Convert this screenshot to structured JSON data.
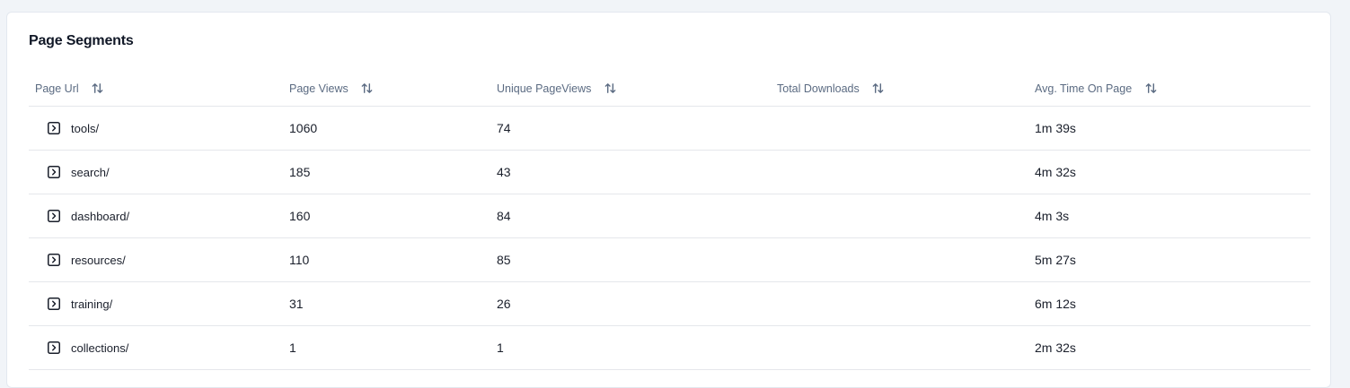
{
  "card": {
    "title": "Page Segments"
  },
  "table": {
    "columns": [
      {
        "key": "page_url",
        "label": "Page Url",
        "icon": "sort-icon"
      },
      {
        "key": "page_views",
        "label": "Page Views",
        "icon": "sort-icon"
      },
      {
        "key": "unique_pageviews",
        "label": "Unique PageViews",
        "icon": "sort-icon"
      },
      {
        "key": "total_downloads",
        "label": "Total Downloads",
        "icon": "sort-icon"
      },
      {
        "key": "avg_time",
        "label": "Avg. Time On Page",
        "icon": "sort-icon"
      }
    ],
    "rows": [
      {
        "page_url": "tools/",
        "page_views": "1060",
        "unique_pageviews": "74",
        "total_downloads": "",
        "avg_time": "1m 39s"
      },
      {
        "page_url": "search/",
        "page_views": "185",
        "unique_pageviews": "43",
        "total_downloads": "",
        "avg_time": "4m 32s"
      },
      {
        "page_url": "dashboard/",
        "page_views": "160",
        "unique_pageviews": "84",
        "total_downloads": "",
        "avg_time": "4m 3s"
      },
      {
        "page_url": "resources/",
        "page_views": "110",
        "unique_pageviews": "85",
        "total_downloads": "",
        "avg_time": "5m 27s"
      },
      {
        "page_url": "training/",
        "page_views": "31",
        "unique_pageviews": "26",
        "total_downloads": "",
        "avg_time": "6m 12s"
      },
      {
        "page_url": "collections/",
        "page_views": "1",
        "unique_pageviews": "1",
        "total_downloads": "",
        "avg_time": "2m 32s"
      }
    ],
    "row_icon": "expand-row-icon"
  },
  "colors": {
    "background": "#f1f4f8",
    "card": "#ffffff",
    "header_text": "#5b6b82",
    "border": "#e5e7eb",
    "text": "#1a1f2b"
  }
}
